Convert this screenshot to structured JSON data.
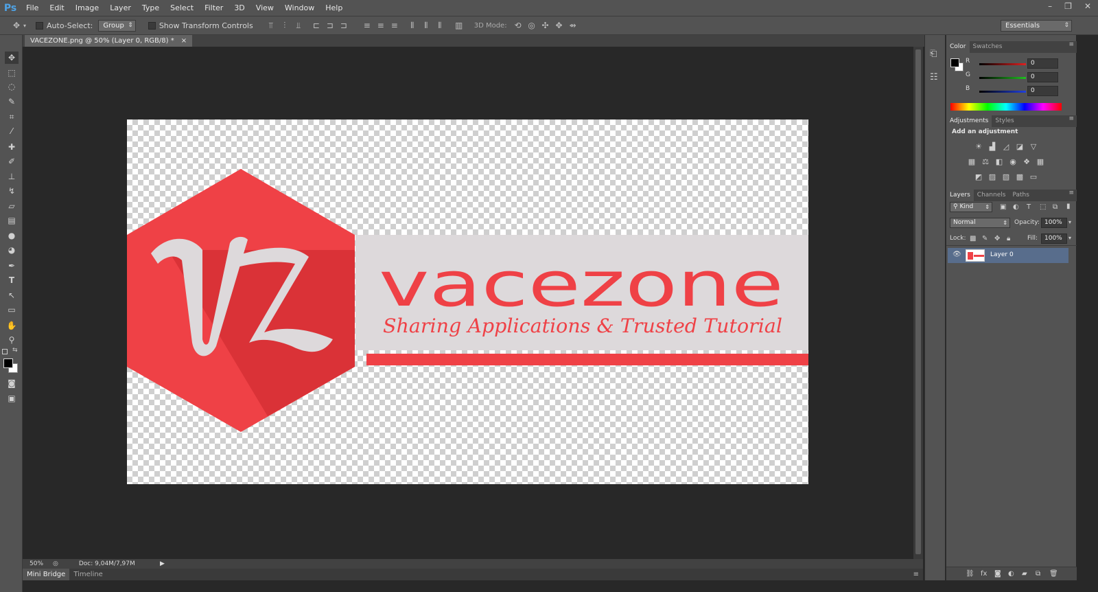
{
  "app": {
    "logo": "Ps"
  },
  "menu": [
    "File",
    "Edit",
    "Image",
    "Layer",
    "Type",
    "Select",
    "Filter",
    "3D",
    "View",
    "Window",
    "Help"
  ],
  "window_controls": [
    "–",
    "❐",
    "✕"
  ],
  "options_bar": {
    "auto_select_label": "Auto-Select:",
    "auto_select_value": "Group",
    "transform_label": "Show Transform Controls",
    "mode_label": "3D Mode:",
    "workspace": "Essentials"
  },
  "document": {
    "tab_title": "VACEZONE.png @ 50% (Layer 0, RGB/8) *",
    "close": "×",
    "zoom": "50%",
    "doc_size": "Doc: 9,04M/7,97M"
  },
  "artwork": {
    "monogram": "VZ",
    "brand": "vacezone",
    "tagline": "Sharing Applications & Trusted Tutorial",
    "brand_color": "#ef4146",
    "band_color": "#ddd9db"
  },
  "bottom_tabs": [
    "Mini Bridge",
    "Timeline"
  ],
  "color_panel": {
    "tabs": [
      "Color",
      "Swatches"
    ],
    "channels": [
      {
        "label": "R",
        "value": "0",
        "color": "#e02020"
      },
      {
        "label": "G",
        "value": "0",
        "color": "#20c020"
      },
      {
        "label": "B",
        "value": "0",
        "color": "#2040e0"
      }
    ]
  },
  "adjustments_panel": {
    "tabs": [
      "Adjustments",
      "Styles"
    ],
    "heading": "Add an adjustment"
  },
  "layers_panel": {
    "tabs": [
      "Layers",
      "Channels",
      "Paths"
    ],
    "filter": "Kind",
    "blend_mode": "Normal",
    "opacity_label": "Opacity:",
    "opacity": "100%",
    "lock_label": "Lock:",
    "fill_label": "Fill:",
    "fill": "100%",
    "layer_name": "Layer 0"
  }
}
